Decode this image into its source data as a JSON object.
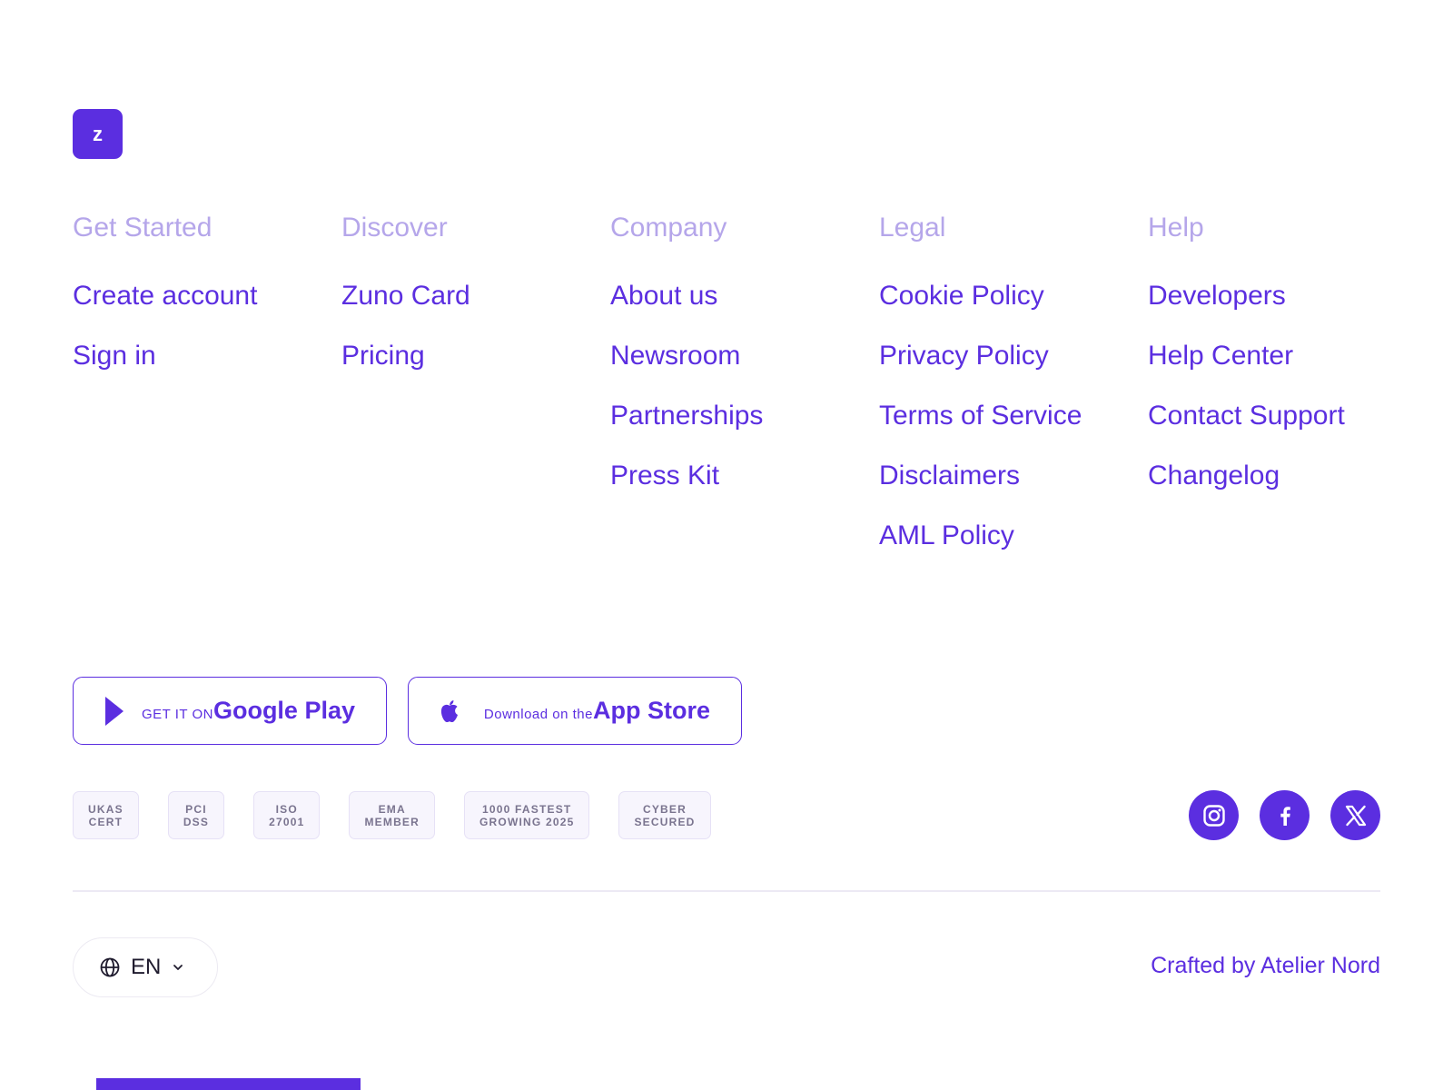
{
  "brand": {
    "logo_letter": "z",
    "accent": "#5b2ee0",
    "heading_color": "#b5a6ea"
  },
  "columns": [
    {
      "heading": "Get Started",
      "links": [
        "Create account",
        "Sign in"
      ]
    },
    {
      "heading": "Discover",
      "links": [
        "Zuno Card",
        "Pricing"
      ]
    },
    {
      "heading": "Company",
      "links": [
        "About us",
        "Newsroom",
        "Partnerships",
        "Press Kit"
      ]
    },
    {
      "heading": "Legal",
      "links": [
        "Cookie Policy",
        "Privacy Policy",
        "Terms of Service",
        "Disclaimers",
        "AML Policy"
      ]
    },
    {
      "heading": "Help",
      "links": [
        "Developers",
        "Help Center",
        "Contact Support",
        "Changelog"
      ]
    }
  ],
  "stores": {
    "google_play": {
      "small": "GET IT ON",
      "big": "Google Play",
      "icon": "play-triangle-icon"
    },
    "app_store": {
      "small": "Download on the",
      "big": "App Store",
      "icon": "apple-icon"
    }
  },
  "badges": [
    [
      "UKAS",
      "CERT"
    ],
    [
      "PCI",
      "DSS"
    ],
    [
      "ISO",
      "27001"
    ],
    [
      "EMA",
      "MEMBER"
    ],
    [
      "1000 FASTEST",
      "GROWING 2025"
    ],
    [
      "CYBER",
      "SECURED"
    ]
  ],
  "socials": [
    "instagram-icon",
    "facebook-icon",
    "x-icon"
  ],
  "language": {
    "code": "EN",
    "icon": "globe-icon"
  },
  "crafted_by": "Crafted by Atelier Nord"
}
